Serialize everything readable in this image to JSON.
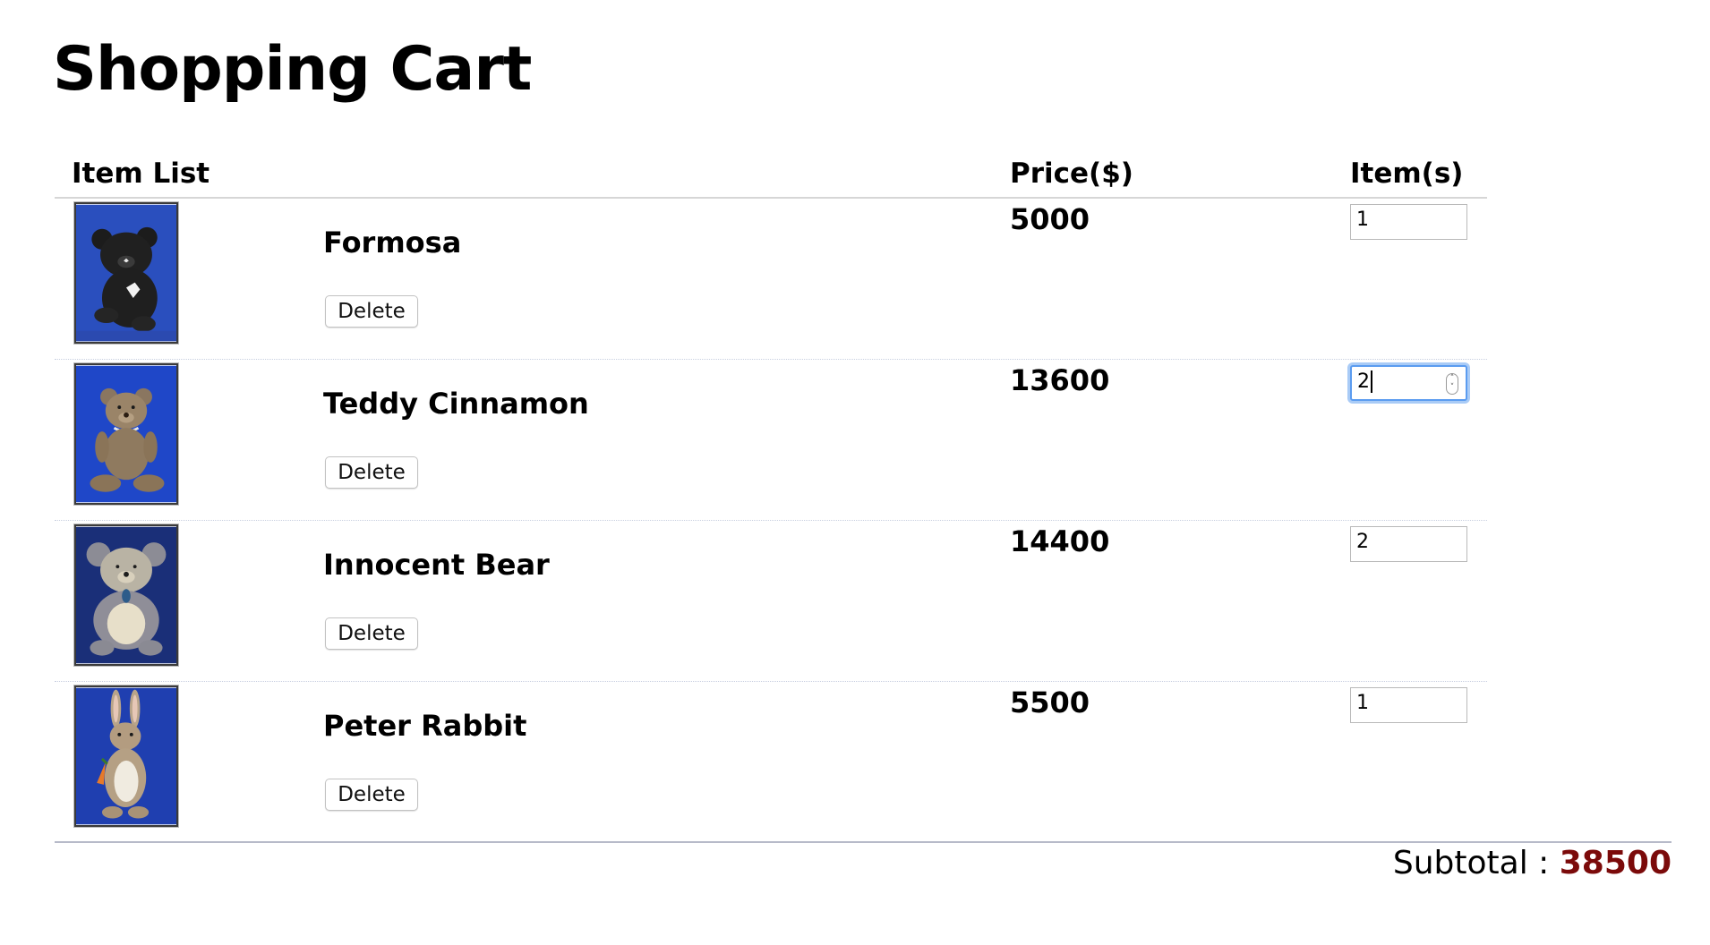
{
  "page": {
    "title": "Shopping Cart"
  },
  "table": {
    "headers": {
      "items": "Item List",
      "price": "Price($)",
      "qty": "Item(s)"
    }
  },
  "items": [
    {
      "name": "Formosa",
      "price": "5000",
      "qty": "1",
      "delete_label": "Delete",
      "image_icon": "black-teddy-bear-photo"
    },
    {
      "name": "Teddy Cinnamon",
      "price": "13600",
      "qty": "2",
      "delete_label": "Delete",
      "image_icon": "brown-teddy-bear-photo"
    },
    {
      "name": "Innocent Bear",
      "price": "14400",
      "qty": "2",
      "delete_label": "Delete",
      "image_icon": "grey-teddy-bear-photo"
    },
    {
      "name": "Peter Rabbit",
      "price": "5500",
      "qty": "1",
      "delete_label": "Delete",
      "image_icon": "rabbit-plush-photo"
    }
  ],
  "summary": {
    "subtotal_label": "Subtotal : ",
    "subtotal_value": "38500"
  },
  "colors": {
    "subtotal_value": "#7b0a0a",
    "photo_background": "#1f47b8",
    "focus_ring": "#5b9cf0"
  }
}
